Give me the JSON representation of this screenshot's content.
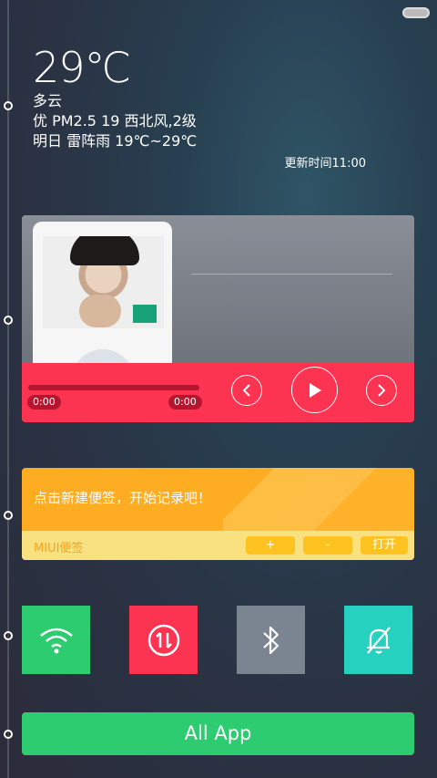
{
  "weather": {
    "temperature": "29℃",
    "condition": "多云",
    "air": "优 PM2.5 19 西北风,2级",
    "tomorrow": "明日 雷阵雨 19℃~29℃",
    "updated": "更新时间11:00"
  },
  "music": {
    "time_elapsed": "0:00",
    "time_total": "0:00",
    "progress": 0,
    "icons": [
      "prev-icon",
      "play-icon",
      "next-icon"
    ]
  },
  "note": {
    "prompt": "点击新建便签，开始记录吧！",
    "brand": "MIUI便签",
    "add_label": "+",
    "remove_label": "-",
    "open_label": "打开"
  },
  "toggles": [
    {
      "name": "wifi",
      "icon": "wifi-icon",
      "color": "#2ecc71"
    },
    {
      "name": "mobile-data",
      "icon": "data-sync-icon",
      "color": "#fd3352"
    },
    {
      "name": "bluetooth",
      "icon": "bluetooth-icon",
      "color": "#7b8591"
    },
    {
      "name": "silent",
      "icon": "bell-off-icon",
      "color": "#26d1bf"
    }
  ],
  "all_app_label": "All App",
  "colors": {
    "accent_red": "#fd3352",
    "accent_green": "#2ecc71",
    "note_orange": "#feac22",
    "accent_teal": "#26d1bf"
  }
}
